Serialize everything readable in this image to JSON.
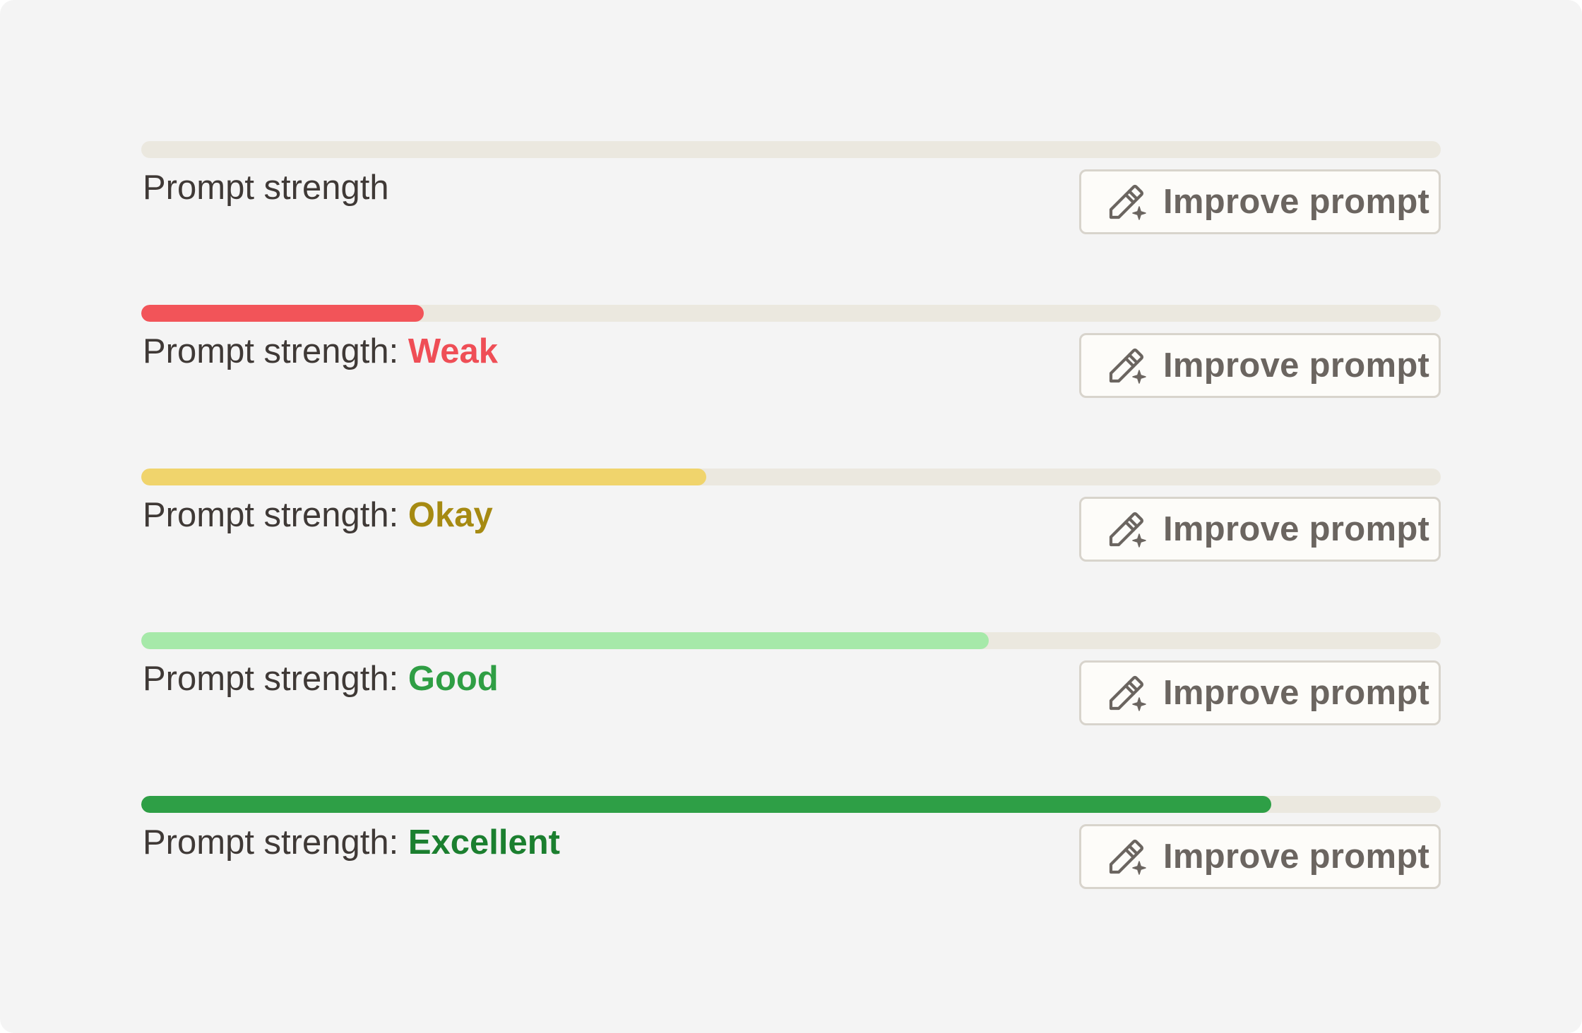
{
  "colors": {
    "track": "#ebe8df",
    "label_text": "#3f3936",
    "button_text": "#6b6560",
    "button_border": "#d8d4cc"
  },
  "rows": [
    {
      "label": "Prompt strength",
      "rating": "",
      "progress": 0,
      "fill_color": "#ebe8df",
      "rating_color": "#3f3936",
      "button_label": "Improve prompt",
      "button_icon": "pencil-sparkle-icon"
    },
    {
      "label": "Prompt strength: ",
      "rating": "Weak",
      "progress": 0.2174,
      "fill_color": "#f25459",
      "rating_color": "#ef4e56",
      "button_label": "Improve prompt",
      "button_icon": "pencil-sparkle-icon"
    },
    {
      "label": "Prompt strength: ",
      "rating": "Okay",
      "progress": 0.4348,
      "fill_color": "#f0d46c",
      "rating_color": "#a68a12",
      "button_label": "Improve prompt",
      "button_icon": "pencil-sparkle-icon"
    },
    {
      "label": "Prompt strength: ",
      "rating": "Good",
      "progress": 0.6522,
      "fill_color": "#a6e9a9",
      "rating_color": "#2f9e44",
      "button_label": "Improve prompt",
      "button_icon": "pencil-sparkle-icon"
    },
    {
      "label": "Prompt strength: ",
      "rating": "Excellent",
      "progress": 0.8696,
      "fill_color": "#2e9f46",
      "rating_color": "#1b7f2f",
      "button_label": "Improve prompt",
      "button_icon": "pencil-sparkle-icon"
    }
  ]
}
